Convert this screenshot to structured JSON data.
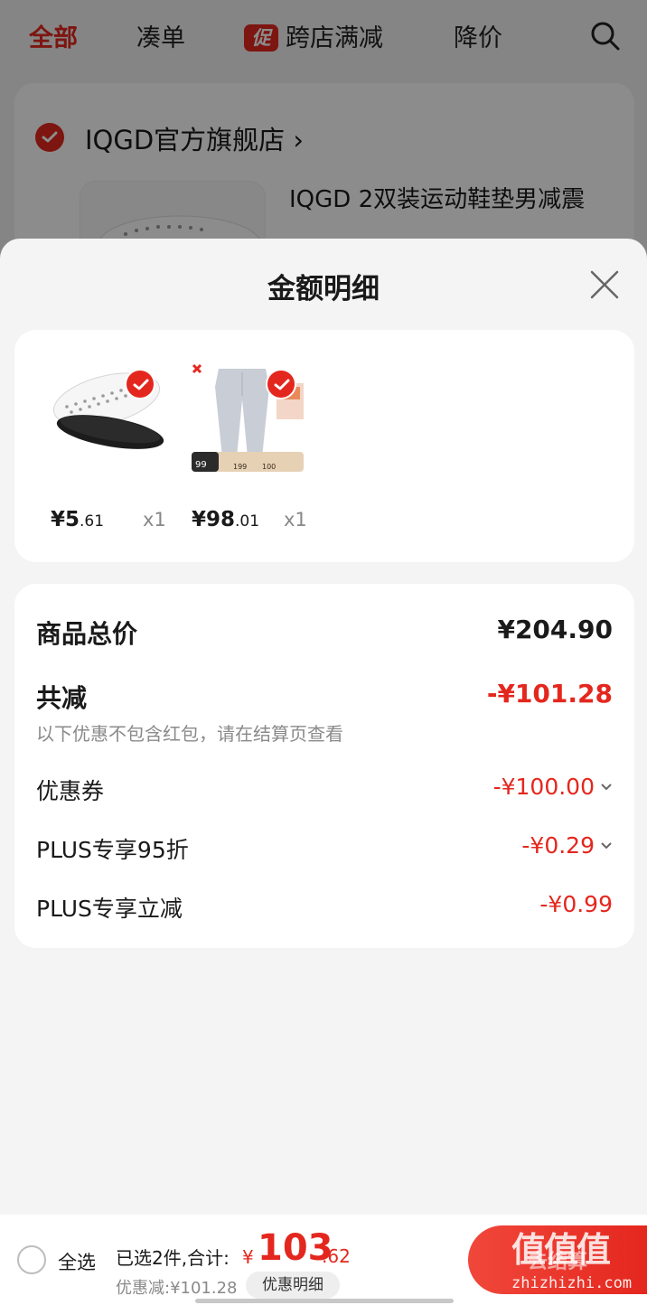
{
  "top_nav": {
    "tabs": [
      "全部",
      "凑单",
      "跨店满减",
      "降价"
    ],
    "promo_badge": "促",
    "active_color": "#e4271e"
  },
  "store": {
    "name": "IQGD官方旗舰店",
    "chevron": "›",
    "product_title": "IQGD 2双装运动鞋垫男减震"
  },
  "sheet": {
    "title": "金额明细",
    "items": [
      {
        "price_int": "¥5",
        "price_dec": ".61",
        "qty": "x1",
        "image": "insole-photo"
      },
      {
        "price_int": "¥98",
        "price_dec": ".01",
        "qty": "x1",
        "image": "sweatpants-photo",
        "img_badge_values": [
          "99",
          "199",
          "100"
        ]
      }
    ],
    "summary": {
      "total_label": "商品总价",
      "total_value": "¥204.90",
      "discount_label": "共减",
      "discount_value": "-¥101.28",
      "note": "以下优惠不包含红包，请在结算页查看",
      "rows": [
        {
          "label": "优惠券",
          "value": "-¥100.00",
          "expandable": true
        },
        {
          "label": "PLUS专享95折",
          "value": "-¥0.29",
          "expandable": true
        },
        {
          "label": "PLUS专享立减",
          "value": "-¥0.99",
          "expandable": false
        }
      ]
    }
  },
  "bottom_bar": {
    "select_all": "全选",
    "selected_text": "已选2件,合计:",
    "total_yen": "¥",
    "total_int": "103",
    "total_dec": ".62",
    "discount_text": "优惠减:¥101.28",
    "detail_button": "优惠明细",
    "checkout_label": "去结算",
    "watermark_logo": "值值值",
    "watermark_url": "zhizhizhi.com"
  },
  "colors": {
    "accent": "#e4271e",
    "card": "#ffffff",
    "sheet_bg": "#f4f4f4"
  }
}
